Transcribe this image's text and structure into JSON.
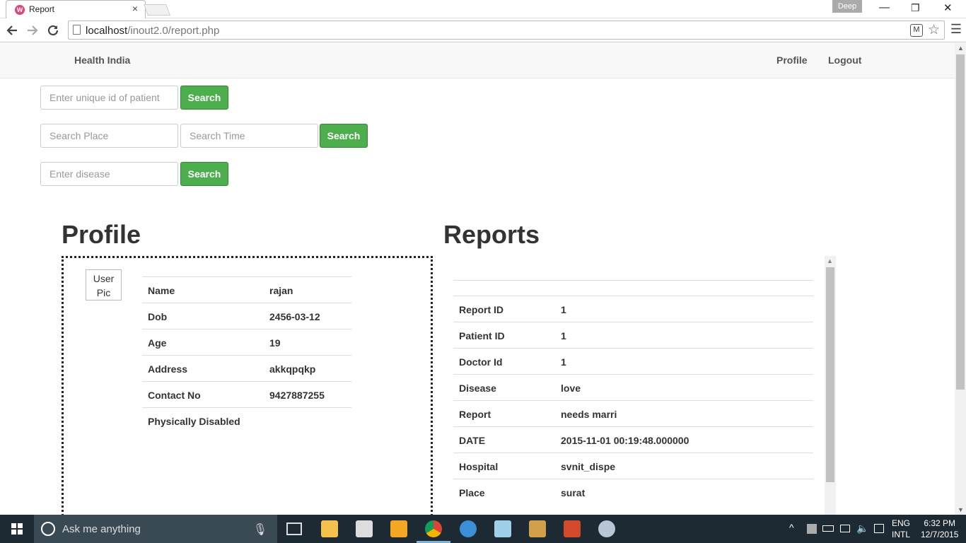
{
  "browser": {
    "tab_title": "Report",
    "tab_close": "×",
    "favicon_letter": "W",
    "user_badge": "Deep",
    "window_controls": {
      "minimize": "—",
      "restore": "❐",
      "close": "✕"
    },
    "url_host": "localhost",
    "url_path": "/inout2.0/report.php"
  },
  "navbar": {
    "brand": "Health India",
    "links": [
      "Profile",
      "Logout"
    ]
  },
  "search": {
    "unique_id_placeholder": "Enter unique id of patient",
    "place_placeholder": "Search Place",
    "time_placeholder": "Search Time",
    "disease_placeholder": "Enter disease",
    "button_label": "Search"
  },
  "profile": {
    "heading": "Profile",
    "pic_alt": "User Pic",
    "rows": [
      {
        "label": "Name",
        "value": "rajan"
      },
      {
        "label": "Dob",
        "value": "2456-03-12"
      },
      {
        "label": "Age",
        "value": "19"
      },
      {
        "label": "Address",
        "value": "akkqpqkp"
      },
      {
        "label": "Contact No",
        "value": "9427887255"
      },
      {
        "label": "Physically Disabled",
        "value": ""
      }
    ]
  },
  "reports": {
    "heading": "Reports",
    "rows": [
      {
        "label": "Report ID",
        "value": "1"
      },
      {
        "label": "Patient ID",
        "value": "1"
      },
      {
        "label": "Doctor Id",
        "value": "1"
      },
      {
        "label": "Disease",
        "value": "love"
      },
      {
        "label": "Report",
        "value": "needs marri"
      },
      {
        "label": "DATE",
        "value": "2015-11-01 00:19:48.000000"
      },
      {
        "label": "Hospital",
        "value": "svnit_dispe"
      },
      {
        "label": "Place",
        "value": "surat"
      }
    ]
  },
  "taskbar": {
    "search_text": "Ask me anything",
    "lang_top": "ENG",
    "lang_bottom": "INTL",
    "time": "6:32 PM",
    "date": "12/7/2015"
  },
  "colors": {
    "search_button": "#4cae4c",
    "taskbar": "#1d2a33"
  }
}
